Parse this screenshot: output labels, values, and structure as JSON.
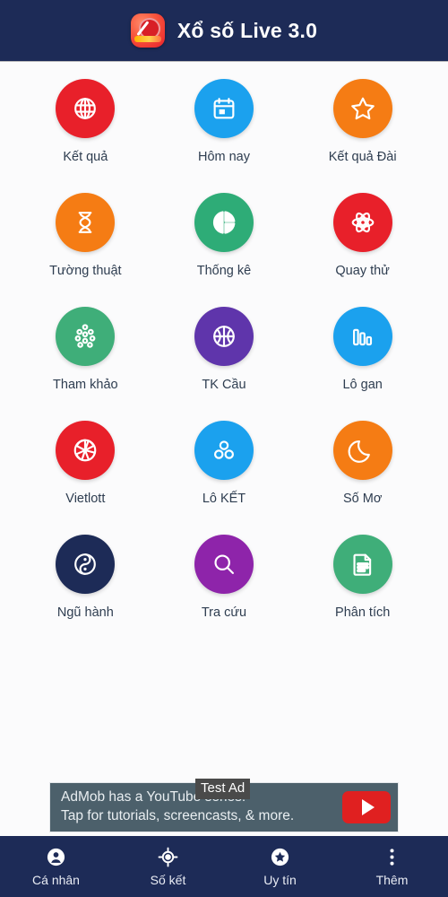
{
  "header": {
    "title": "Xổ số Live 3.0",
    "logo_icon": "app-logo-icon",
    "bg_color": "#1d2b57"
  },
  "grid": {
    "tiles": [
      {
        "label": "Kết quả",
        "icon": "globe-icon",
        "color": "#e8202a"
      },
      {
        "label": "Hôm nay",
        "icon": "calendar-icon",
        "color": "#1ba1ee"
      },
      {
        "label": "Kết quả Đài",
        "icon": "star-icon",
        "color": "#f57c14"
      },
      {
        "label": "Tường thuật",
        "icon": "hourglass-icon",
        "color": "#f57c14"
      },
      {
        "label": "Thống kê",
        "icon": "pie-chart-icon",
        "color": "#2eac77"
      },
      {
        "label": "Quay thử",
        "icon": "atom-icon",
        "color": "#e8202a"
      },
      {
        "label": "Tham khảo",
        "icon": "dot-grid-icon",
        "color": "#3fae79"
      },
      {
        "label": "TK Cầu",
        "icon": "basketball-icon",
        "color": "#5f35ab"
      },
      {
        "label": "Lô gan",
        "icon": "bar-chart-icon",
        "color": "#1ba1ee"
      },
      {
        "label": "Vietlott",
        "icon": "beachball-icon",
        "color": "#e8202a"
      },
      {
        "label": "Lô KẾT",
        "icon": "three-dots-icon",
        "color": "#1ba1ee"
      },
      {
        "label": "Số Mơ",
        "icon": "moon-icon",
        "color": "#f57c14"
      },
      {
        "label": "Ngũ hành",
        "icon": "yin-yang-icon",
        "color": "#1d2b57"
      },
      {
        "label": "Tra cứu",
        "icon": "magnifier-icon",
        "color": "#8e24aa"
      },
      {
        "label": "Phân tích",
        "icon": "document-icon",
        "color": "#3fae79"
      }
    ]
  },
  "ad": {
    "badge": "Test Ad",
    "line1": "AdMob has a YouTube series!",
    "line2": "Tap for tutorials, screencasts, & more.",
    "play_icon": "youtube-play-icon"
  },
  "bottom_nav": {
    "items": [
      {
        "label": "Cá nhân",
        "icon": "person-icon"
      },
      {
        "label": "Số kết",
        "icon": "target-icon"
      },
      {
        "label": "Uy tín",
        "icon": "star-badge-icon"
      },
      {
        "label": "Thêm",
        "icon": "overflow-menu-icon"
      }
    ]
  }
}
